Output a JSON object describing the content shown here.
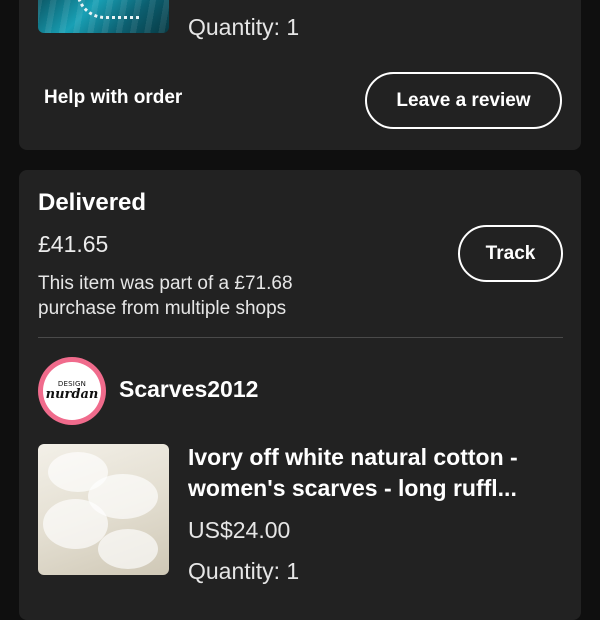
{
  "previous_order": {
    "quantity": "Quantity: 1",
    "help_label": "Help with order",
    "review_label": "Leave a review"
  },
  "order": {
    "status": "Delivered",
    "total": "£41.65",
    "note": "This item was part of a £71.68 purchase from multiple shops",
    "track_label": "Track",
    "shop": {
      "logo_small": "DESIGN",
      "logo_main": "nurdan",
      "name": "Scarves2012"
    },
    "item": {
      "title": "Ivory off white natural cotton -women's scarves - long ruffl...",
      "price": "US$24.00",
      "quantity": "Quantity: 1"
    }
  },
  "colors": {
    "background": "#0f0f0f",
    "card": "#222222",
    "avatar_ring": "#f06b8c"
  }
}
